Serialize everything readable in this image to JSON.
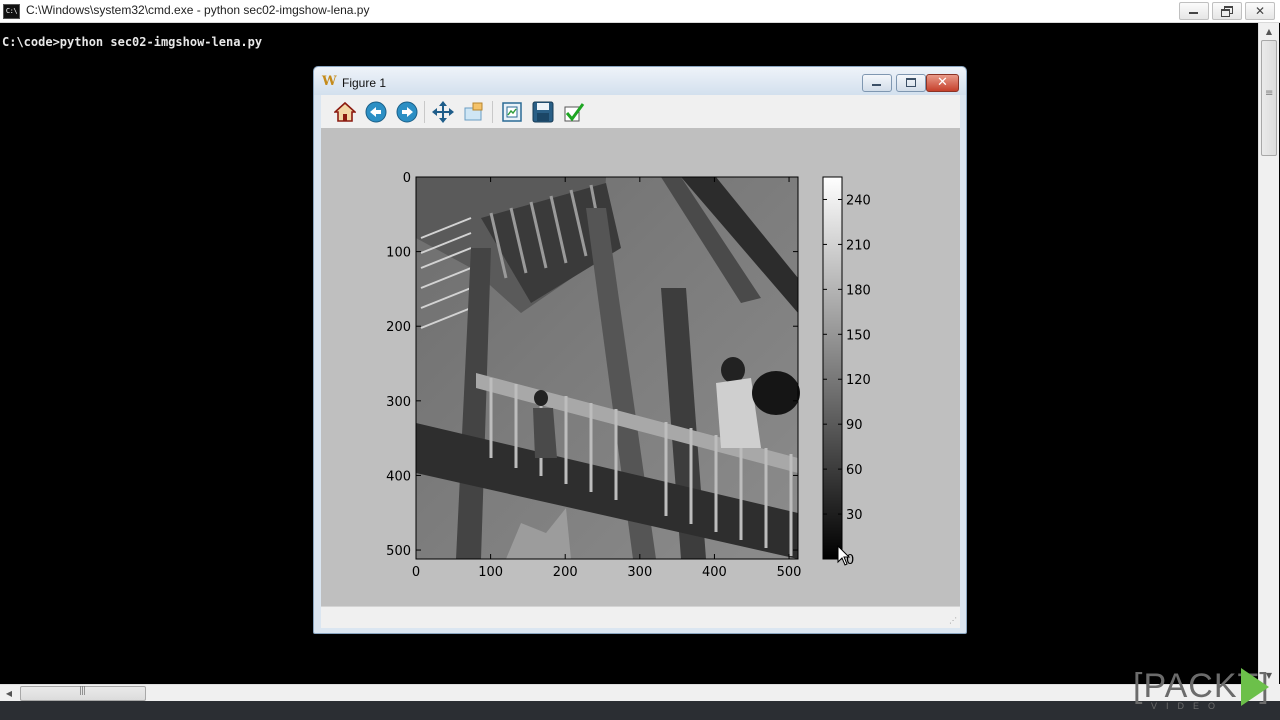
{
  "console": {
    "title": "C:\\Windows\\system32\\cmd.exe - python  sec02-imgshow-lena.py",
    "icon_text": "C:\\",
    "command_line": "C:\\code>python sec02-imgshow-lena.py"
  },
  "figure_window": {
    "title": "Figure 1",
    "toolbar": [
      {
        "name": "home-icon",
        "tooltip": "Home"
      },
      {
        "name": "back-icon",
        "tooltip": "Back"
      },
      {
        "name": "forward-icon",
        "tooltip": "Forward"
      },
      {
        "name": "pan-icon",
        "tooltip": "Pan"
      },
      {
        "name": "zoom-icon",
        "tooltip": "Zoom"
      },
      {
        "name": "subplots-icon",
        "tooltip": "Configure subplots"
      },
      {
        "name": "save-icon",
        "tooltip": "Save"
      },
      {
        "name": "edit-axes-icon",
        "tooltip": "Edit axes"
      }
    ],
    "status_text": ""
  },
  "chart_data": {
    "type": "heatmap",
    "description_of_image": "grayscale photograph of a staircase with people climbing",
    "x_ticks": [
      0,
      100,
      200,
      300,
      400,
      500
    ],
    "y_ticks": [
      0,
      100,
      200,
      300,
      400,
      500
    ],
    "xlim": [
      0,
      512
    ],
    "ylim": [
      512,
      0
    ],
    "colorbar": {
      "cmap": "gray",
      "ticks": [
        0,
        30,
        60,
        90,
        120,
        150,
        180,
        210,
        240
      ],
      "range": [
        0,
        255
      ]
    }
  },
  "watermark": {
    "brand": "[PACKT]",
    "sub": "VIDEO"
  },
  "colors": {
    "console_bg": "#000000",
    "console_text": "#e8e8e8",
    "figure_bg": "#bfbfbf",
    "brand_green": "#6cc04a"
  }
}
